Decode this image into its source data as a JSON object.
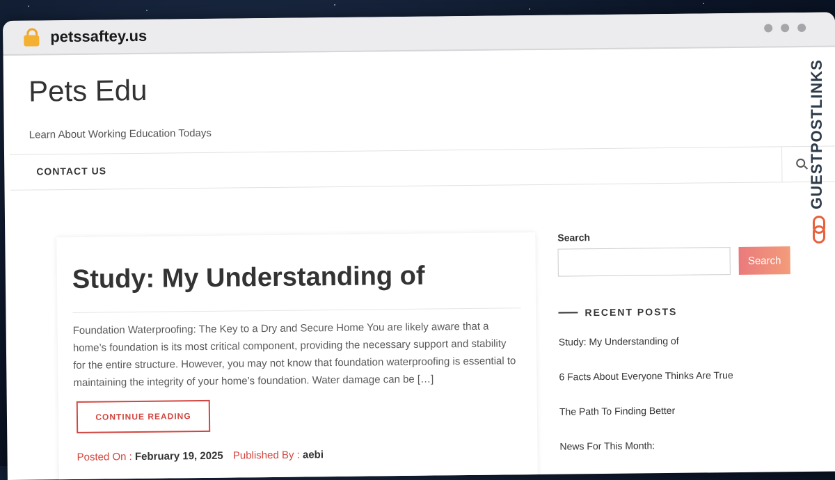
{
  "browser": {
    "url": "petssaftey.us"
  },
  "site": {
    "title": "Pets Edu",
    "tagline": "Learn About Working Education Todays"
  },
  "nav": {
    "items": [
      {
        "label": "CONTACT US"
      }
    ]
  },
  "post": {
    "title": "Study: My Understanding of",
    "excerpt": "Foundation Waterproofing: The Key to a Dry and Secure Home You are likely aware that a home’s foundation is its most critical component, providing the necessary support and stability for the entire structure. However, you may not know that foundation waterproofing is essential to maintaining the integrity of your home’s foundation. Water damage can be […]",
    "continue_label": "CONTINUE READING",
    "posted_on_label": "Posted On :",
    "posted_on": "February 19, 2025",
    "published_by_label": "Published By :",
    "author": "aebi"
  },
  "sidebar": {
    "search_label": "Search",
    "search_value": "",
    "search_button": "Search",
    "recent_heading": "RECENT POSTS",
    "recent_posts": [
      "Study: My Understanding of",
      "6 Facts About Everyone Thinks Are True",
      "The Path To Finding Better",
      "News For This Month:"
    ]
  },
  "watermark": {
    "text": "GUESTPOSTLINKS"
  },
  "colors": {
    "accent": "#d2453f",
    "search_button": "#ef8a7b",
    "lock": "#f4b030"
  }
}
